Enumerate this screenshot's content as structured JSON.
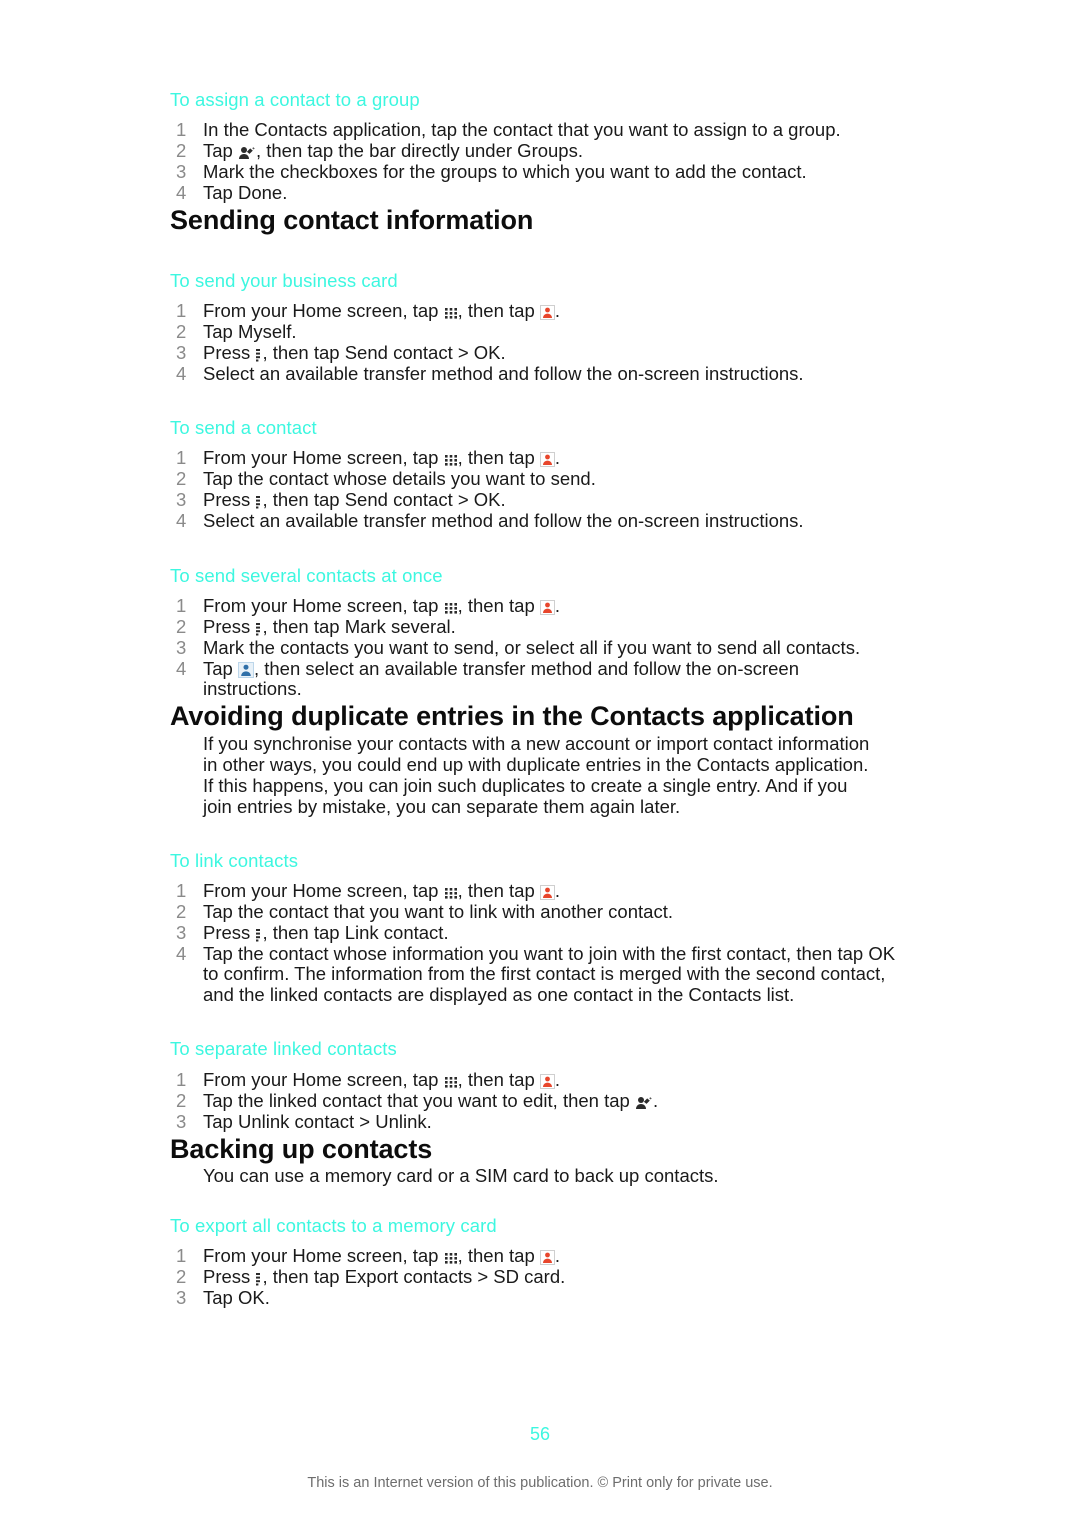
{
  "document": {
    "page_number": "56",
    "footer_note": "This is an Internet version of this publication. © Print only for private use.",
    "accent_color": "#3df7e0"
  },
  "icons": {
    "app_drawer": "app-drawer-grid-icon",
    "contacts_app": "contacts-app-icon",
    "menu_key": "menu-key-icon",
    "person_blue": "person-blue-icon",
    "edit_contact": "edit-contact-icon"
  },
  "sections": {
    "assign_group": {
      "subheading": "To assign a contact to a group",
      "steps": {
        "s1": "In the Contacts application, tap the contact that you want to assign to a group.",
        "s2_a": "Tap ",
        "s2_b": ", then tap the bar directly under Groups.",
        "s3": "Mark the checkboxes for the groups to which you want to add the contact.",
        "s4": "Tap Done."
      }
    },
    "sending_contact_information": {
      "title": "Sending contact information",
      "business_card": {
        "subheading": "To send your business card",
        "steps": {
          "s1_a": "From your Home screen, tap ",
          "s1_b": ", then tap ",
          "s1_c": ".",
          "s2": "Tap Myself.",
          "s3_a": "Press ",
          "s3_b": ", then tap Send contact > OK.",
          "s4": "Select an available transfer method and follow the on-screen instructions."
        }
      },
      "send_contact": {
        "subheading": "To send a contact",
        "steps": {
          "s1_a": "From your Home screen, tap ",
          "s1_b": ", then tap ",
          "s1_c": ".",
          "s2": "Tap the contact whose details you want to send.",
          "s3_a": "Press ",
          "s3_b": ", then tap Send contact > OK.",
          "s4": "Select an available transfer method and follow the on-screen instructions."
        }
      },
      "send_several": {
        "subheading": "To send several contacts at once",
        "steps": {
          "s1_a": "From your Home screen, tap ",
          "s1_b": ", then tap ",
          "s1_c": ".",
          "s2_a": "Press ",
          "s2_b": ", then tap Mark several.",
          "s3": "Mark the contacts you want to send, or select all if you want to send all contacts.",
          "s4_a": "Tap ",
          "s4_b": ", then select an available transfer method and follow the on-screen instructions."
        }
      }
    },
    "avoiding_duplicates": {
      "title": "Avoiding duplicate entries in the Contacts application",
      "paragraph": "If you synchronise your contacts with a new account or import contact information in other ways, you could end up with duplicate entries in the Contacts application. If this happens, you can join such duplicates to create a single entry. And if you join entries by mistake, you can separate them again later.",
      "link_contacts": {
        "subheading": "To link contacts",
        "steps": {
          "s1_a": "From your Home screen, tap ",
          "s1_b": ", then tap ",
          "s1_c": ".",
          "s2": "Tap the contact that you want to link with another contact.",
          "s3_a": "Press ",
          "s3_b": ", then tap Link contact.",
          "s4": "Tap the contact whose information you want to join with the first contact, then tap OK to confirm. The information from the first contact is merged with the second contact, and the linked contacts are displayed as one contact in the Contacts list."
        }
      },
      "separate_linked": {
        "subheading": "To separate linked contacts",
        "steps": {
          "s1_a": "From your Home screen, tap ",
          "s1_b": ", then tap ",
          "s1_c": ".",
          "s2_a": "Tap the linked contact that you want to edit, then tap ",
          "s2_b": ".",
          "s3": "Tap Unlink contact > Unlink."
        }
      }
    },
    "backing_up": {
      "title": "Backing up contacts",
      "paragraph": "You can use a memory card or a SIM card to back up contacts.",
      "export_memory_card": {
        "subheading": "To export all contacts to a memory card",
        "steps": {
          "s1_a": "From your Home screen, tap ",
          "s1_b": ", then tap ",
          "s1_c": ".",
          "s2_a": "Press ",
          "s2_b": ", then tap Export contacts > SD card.",
          "s3": "Tap OK."
        }
      }
    }
  }
}
